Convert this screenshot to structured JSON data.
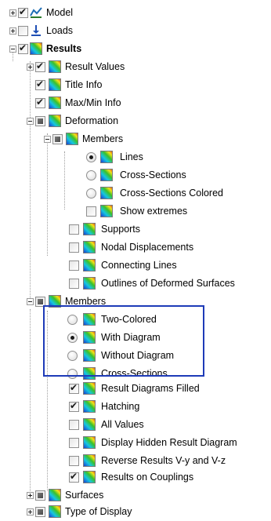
{
  "tree": {
    "items": [
      {
        "label": "Model",
        "expander": "plus",
        "check": "checked",
        "icon": "model-icon",
        "bold": false
      },
      {
        "label": "Loads",
        "expander": "plus",
        "check": "unchecked",
        "icon": "loads-icon",
        "bold": false
      },
      {
        "label": "Results",
        "expander": "minus",
        "check": "checked",
        "icon": "results-icon",
        "bold": true
      },
      {
        "label": "Result Values",
        "expander": "plus",
        "check": "checked",
        "icon": "results-icon",
        "bold": false
      },
      {
        "label": "Title Info",
        "expander": "none",
        "check": "checked",
        "icon": "results-icon",
        "bold": false
      },
      {
        "label": "Max/Min Info",
        "expander": "none",
        "check": "checked",
        "icon": "results-icon",
        "bold": false
      },
      {
        "label": "Deformation",
        "expander": "minus",
        "check": "partial",
        "icon": "results-icon",
        "bold": false
      },
      {
        "label": "Members",
        "expander": "minus",
        "check": "partial",
        "icon": "results-icon",
        "bold": false
      },
      {
        "label": "Lines",
        "expander": "none",
        "check": "radio-selected",
        "icon": "results-icon",
        "bold": false
      },
      {
        "label": "Cross-Sections",
        "expander": "none",
        "check": "radio",
        "icon": "results-icon",
        "bold": false
      },
      {
        "label": "Cross-Sections Colored",
        "expander": "none",
        "check": "radio",
        "icon": "results-icon",
        "bold": false
      },
      {
        "label": "Show extremes",
        "expander": "none",
        "check": "unchecked",
        "icon": "results-icon",
        "bold": false
      },
      {
        "label": "Supports",
        "expander": "none",
        "check": "unchecked",
        "icon": "results-icon",
        "bold": false
      },
      {
        "label": "Nodal Displacements",
        "expander": "none",
        "check": "unchecked",
        "icon": "results-icon",
        "bold": false
      },
      {
        "label": "Connecting Lines",
        "expander": "none",
        "check": "unchecked",
        "icon": "results-icon",
        "bold": false
      },
      {
        "label": "Outlines of Deformed Surfaces",
        "expander": "none",
        "check": "unchecked",
        "icon": "results-icon",
        "bold": false
      },
      {
        "label": "Members",
        "expander": "minus",
        "check": "partial",
        "icon": "results-icon",
        "bold": false
      },
      {
        "label": "Two-Colored",
        "expander": "none",
        "check": "radio",
        "icon": "results-icon",
        "bold": false
      },
      {
        "label": "With Diagram",
        "expander": "none",
        "check": "radio-selected",
        "icon": "results-icon",
        "bold": false
      },
      {
        "label": "Without Diagram",
        "expander": "none",
        "check": "radio",
        "icon": "results-icon",
        "bold": false
      },
      {
        "label": "Cross-Sections",
        "expander": "none",
        "check": "radio",
        "icon": "results-icon",
        "bold": false
      },
      {
        "label": "Result Diagrams Filled",
        "expander": "none",
        "check": "checked",
        "icon": "results-icon",
        "bold": false
      },
      {
        "label": "Hatching",
        "expander": "none",
        "check": "checked",
        "icon": "results-icon",
        "bold": false
      },
      {
        "label": "All Values",
        "expander": "none",
        "check": "unchecked",
        "icon": "results-icon",
        "bold": false
      },
      {
        "label": "Display Hidden Result Diagram",
        "expander": "none",
        "check": "unchecked",
        "icon": "results-icon",
        "bold": false
      },
      {
        "label": "Reverse Results V-y and V-z",
        "expander": "none",
        "check": "unchecked",
        "icon": "results-icon",
        "bold": false
      },
      {
        "label": "Results on Couplings",
        "expander": "none",
        "check": "checked",
        "icon": "results-icon",
        "bold": false
      },
      {
        "label": "Surfaces",
        "expander": "plus",
        "check": "partial",
        "icon": "results-icon",
        "bold": false
      },
      {
        "label": "Type of Display",
        "expander": "plus",
        "check": "partial",
        "icon": "results-icon",
        "bold": false
      }
    ]
  },
  "colors": {
    "highlight_border": "#1e3bb8"
  }
}
